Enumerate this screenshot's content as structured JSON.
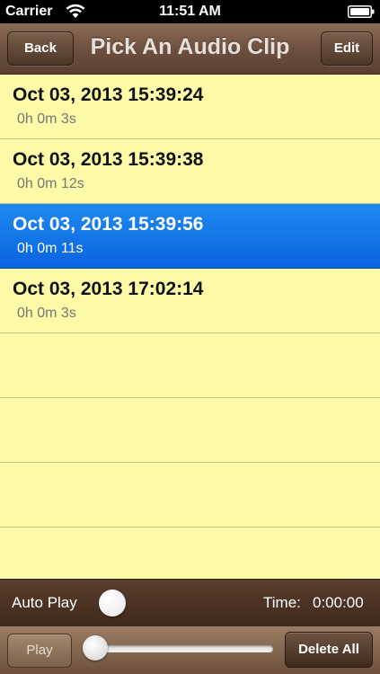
{
  "status_bar": {
    "carrier": "Carrier",
    "time": "11:51 AM",
    "wifi_icon": "wifi-icon",
    "battery_icon": "battery-icon"
  },
  "nav": {
    "title": "Pick An Audio Clip",
    "back_label": "Back",
    "edit_label": "Edit"
  },
  "clips": [
    {
      "title": "Oct 03, 2013 15:39:24",
      "duration": "0h 0m 3s",
      "selected": false
    },
    {
      "title": "Oct 03, 2013 15:39:38",
      "duration": "0h 0m 12s",
      "selected": false
    },
    {
      "title": "Oct 03, 2013 15:39:56",
      "duration": "0h 0m 11s",
      "selected": true
    },
    {
      "title": "Oct 03, 2013 17:02:14",
      "duration": "0h 0m 3s",
      "selected": false
    }
  ],
  "auto_play": {
    "label": "Auto Play",
    "time_label": "Time:",
    "time_value": "0:00:00"
  },
  "toolbar": {
    "play_label": "Play",
    "delete_all_label": "Delete All",
    "progress": 0
  },
  "colors": {
    "list_background": "#fdfaa8",
    "selected_row": "#1e8af0",
    "nav_bar": "#6e5140"
  }
}
